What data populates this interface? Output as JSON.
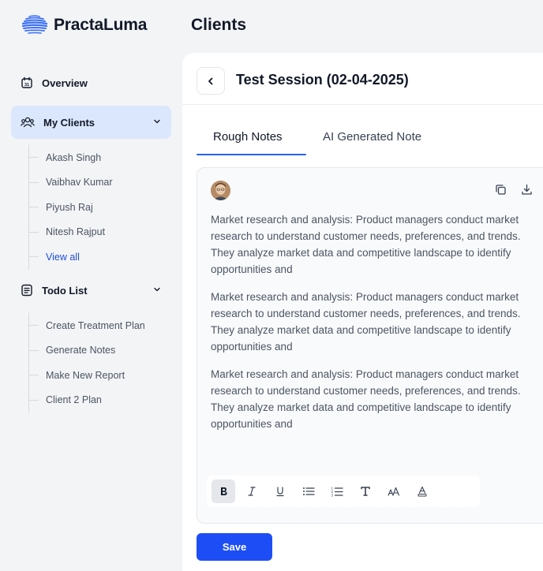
{
  "app": {
    "brand_name": "PractaLuma",
    "page_title": "Clients"
  },
  "sidebar": {
    "overview": {
      "label": "Overview",
      "icon": "calendar-icon"
    },
    "my_clients": {
      "label": "My Clients",
      "icon": "users-icon",
      "items": [
        "Akash Singh",
        "Vaibhav Kumar",
        "Piyush Raj",
        "Nitesh Rajput"
      ],
      "view_all": "View all"
    },
    "todo": {
      "label": "Todo List",
      "icon": "list-icon",
      "items": [
        "Create Treatment Plan",
        "Generate Notes",
        "Make New Report",
        "Client 2 Plan"
      ]
    }
  },
  "session": {
    "title": "Test Session (02-04-2025)",
    "tabs": [
      {
        "label": "Rough Notes",
        "active": true
      },
      {
        "label": "AI Generated Note",
        "active": false
      }
    ]
  },
  "note": {
    "paragraphs": [
      [
        "Market research and analysis: Product managers conduct market",
        "research to understand customer needs, preferences, and trends.",
        "They analyze market data and competitive landscape to identify",
        "opportunities and"
      ],
      [
        "Market research and analysis: Product managers conduct market",
        "research to understand customer needs, preferences, and trends.",
        "They analyze market data and competitive landscape to identify",
        "opportunities and"
      ],
      [
        "Market research and analysis: Product managers conduct market",
        "research to understand customer needs, preferences, and trends.",
        "They analyze market data and competitive landscape to identify",
        "opportunities and"
      ]
    ]
  },
  "toolbar": {
    "tools": [
      "bold-icon",
      "italic-icon",
      "underline-icon",
      "bullet-list-icon",
      "numbered-list-icon",
      "text-icon",
      "font-size-icon",
      "text-color-icon"
    ]
  },
  "actions": {
    "save_label": "Save"
  },
  "colors": {
    "accent": "#1d4ef5",
    "active_nav_bg": "#dbe7fd",
    "link": "#1d4ed8"
  }
}
